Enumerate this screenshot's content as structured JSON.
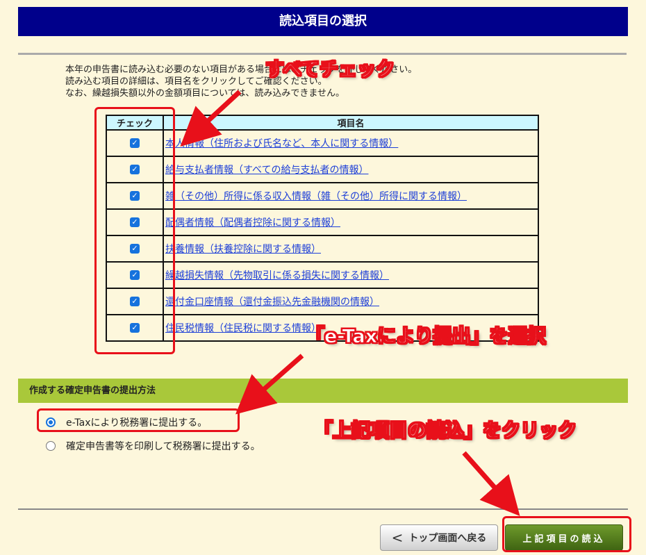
{
  "window": {
    "title": "読込項目の選択"
  },
  "intro": {
    "lines": [
      "本年の申告書に読み込む必要のない項目がある場合には、チェックを外してください。",
      "読み込む項目の詳細は、項目名をクリックしてご確認ください。",
      "なお、繰越損失額以外の金額項目については、読み込みできません。"
    ]
  },
  "table": {
    "headers": {
      "check": "チェック",
      "name": "項目名"
    },
    "rows": [
      {
        "checked": true,
        "label": "本人情報（住所および氏名など、本人に関する情報）"
      },
      {
        "checked": true,
        "label": "給与支払者情報（すべての給与支払者の情報）"
      },
      {
        "checked": true,
        "label": "雑（その他）所得に係る収入情報（雑（その他）所得に関する情報）"
      },
      {
        "checked": true,
        "label": "配偶者情報（配偶者控除に関する情報）"
      },
      {
        "checked": true,
        "label": "扶養情報（扶養控除に関する情報）"
      },
      {
        "checked": true,
        "label": "繰越損失情報（先物取引に係る損失に関する情報）"
      },
      {
        "checked": true,
        "label": "還付金口座情報（還付金振込先金融機関の情報）"
      },
      {
        "checked": true,
        "label": "住民税情報（住民税に関する情報）"
      }
    ]
  },
  "submission": {
    "heading": "作成する確定申告書の提出方法",
    "options": [
      {
        "label": "e-Taxにより税務署に提出する。",
        "selected": true
      },
      {
        "label": "確定申告書等を印刷して税務署に提出する。",
        "selected": false
      }
    ]
  },
  "buttons": {
    "back_chevron": "<",
    "back": "トップ画面へ戻る",
    "load": "上記項目の読込"
  },
  "annotations": {
    "check_all": "すべてチェック",
    "select_etax": "「e-Taxにより提出」を選択",
    "click_load": "「上記項目の読込」をクリック"
  },
  "colors": {
    "title_bar": "#00008b",
    "background": "#fdf7dc",
    "table_header": "#ccf7ff",
    "section_head": "#a9c83a",
    "link": "#1d3fd8",
    "checkbox": "#1672dd",
    "load_button": "#4f7a1c",
    "annotation": "#e8101a"
  }
}
